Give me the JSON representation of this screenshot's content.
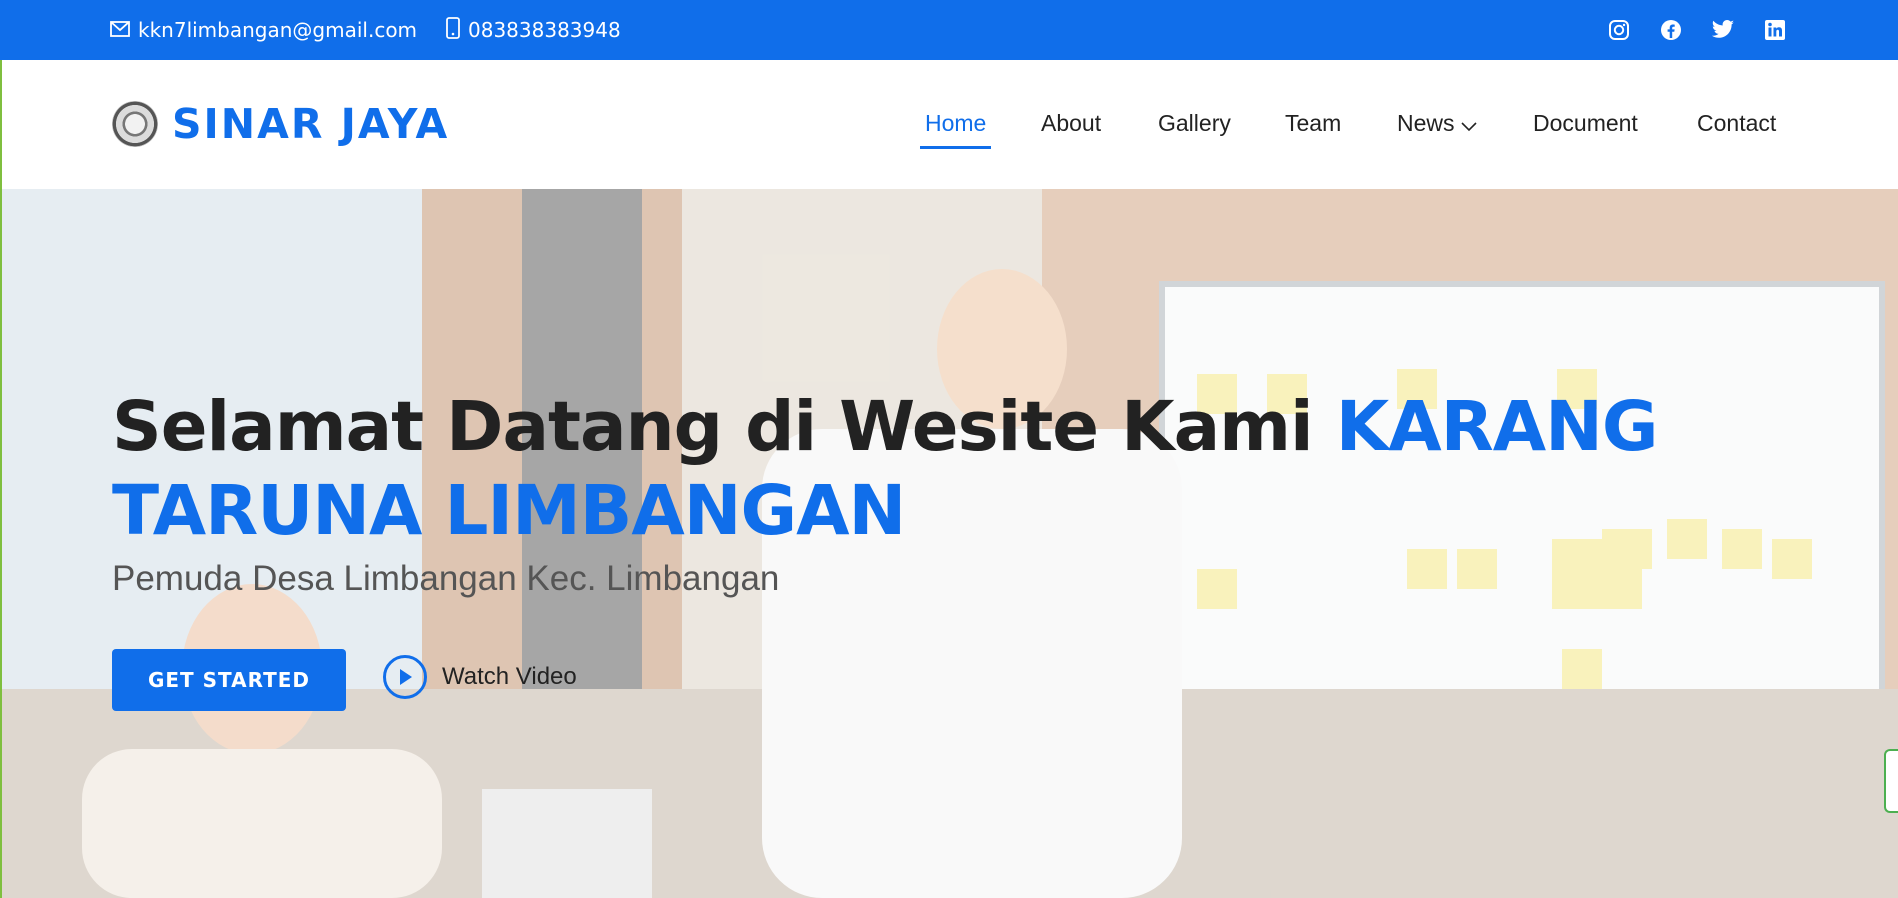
{
  "topbar": {
    "email": "kkn7limbangan@gmail.com",
    "phone": "083838383948",
    "social": [
      "instagram-icon",
      "facebook-icon",
      "twitter-icon",
      "linkedin-icon"
    ]
  },
  "brand": {
    "name": "SINAR JAYA"
  },
  "nav": {
    "home": "Home",
    "about": "About",
    "gallery": "Gallery",
    "team": "Team",
    "news": "News",
    "document": "Document",
    "contact": "Contact"
  },
  "hero": {
    "title_main": "Selamat Datang di Wesite Kami ",
    "title_highlight": "KARANG TARUNA LIMBANGAN",
    "subtitle": "Pemuda Desa Limbangan Kec. Limbangan",
    "cta": "GET STARTED",
    "video": "Watch Video"
  },
  "colors": {
    "accent": "#106eea",
    "text": "#222222"
  }
}
